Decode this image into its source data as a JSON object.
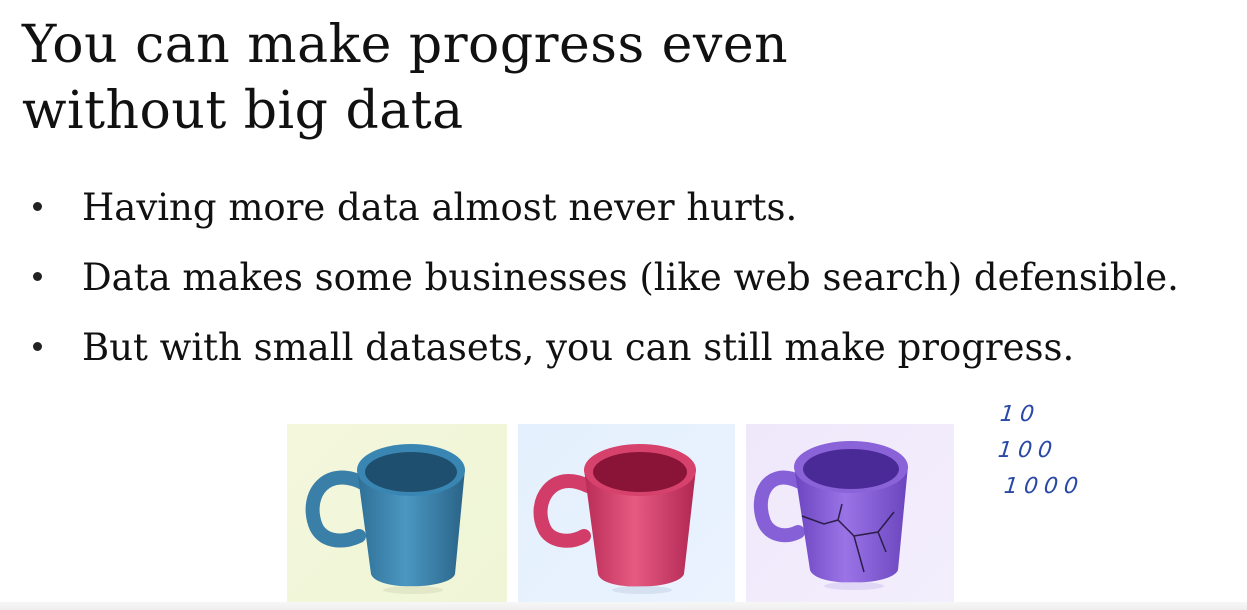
{
  "slide": {
    "title_lines": [
      "You can make progress even",
      "without big data"
    ],
    "bullets": [
      "Having more data almost never hurts.",
      "Data makes some businesses (like web search) defensible.",
      "But with small datasets, you can still make progress."
    ],
    "images": [
      {
        "label": "blue-mug",
        "mug_color": "#3f86b0",
        "background": "#f2f6da"
      },
      {
        "label": "pink-mug",
        "mug_color": "#d9436f",
        "background": "#e7f1fd"
      },
      {
        "label": "purple-cracked-mug",
        "mug_color": "#8a63d8",
        "background": "#f1ebfb"
      }
    ],
    "handwritten_notes": [
      "10",
      "100",
      "1000"
    ],
    "ink_color": "#2a49a6"
  }
}
